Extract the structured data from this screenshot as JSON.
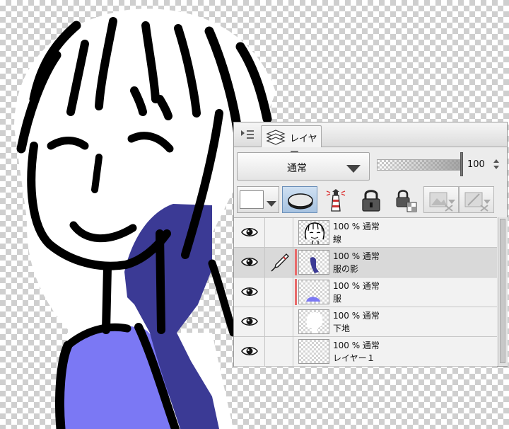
{
  "panel": {
    "tab_label": "レイヤー",
    "blend_mode": "通常",
    "opacity_value": "100",
    "colors": {
      "clip_marker": "#e86a6a",
      "selected_row": "#d9d9d9",
      "active_tool": "#a6c2e0"
    },
    "tool_icons": [
      "rasterize-icon",
      "mask-icon",
      "lock-icon",
      "lock-transparent-icon",
      "clip-icon",
      "reference-icon"
    ],
    "layers": [
      {
        "mode": "100 % 通常",
        "name": "線",
        "selected": false
      },
      {
        "mode": "100 % 通常",
        "name": "服の影",
        "selected": true
      },
      {
        "mode": "100 % 通常",
        "name": "服",
        "selected": false
      },
      {
        "mode": "100 % 通常",
        "name": "下地",
        "selected": false
      },
      {
        "mode": "100 % 通常",
        "name": "レイヤー１",
        "selected": false
      }
    ]
  },
  "artwork": {
    "colors": {
      "shirt": "#7b78f4",
      "shadow": "#3b3a95",
      "skin": "#ffffff",
      "line": "#000000"
    }
  }
}
